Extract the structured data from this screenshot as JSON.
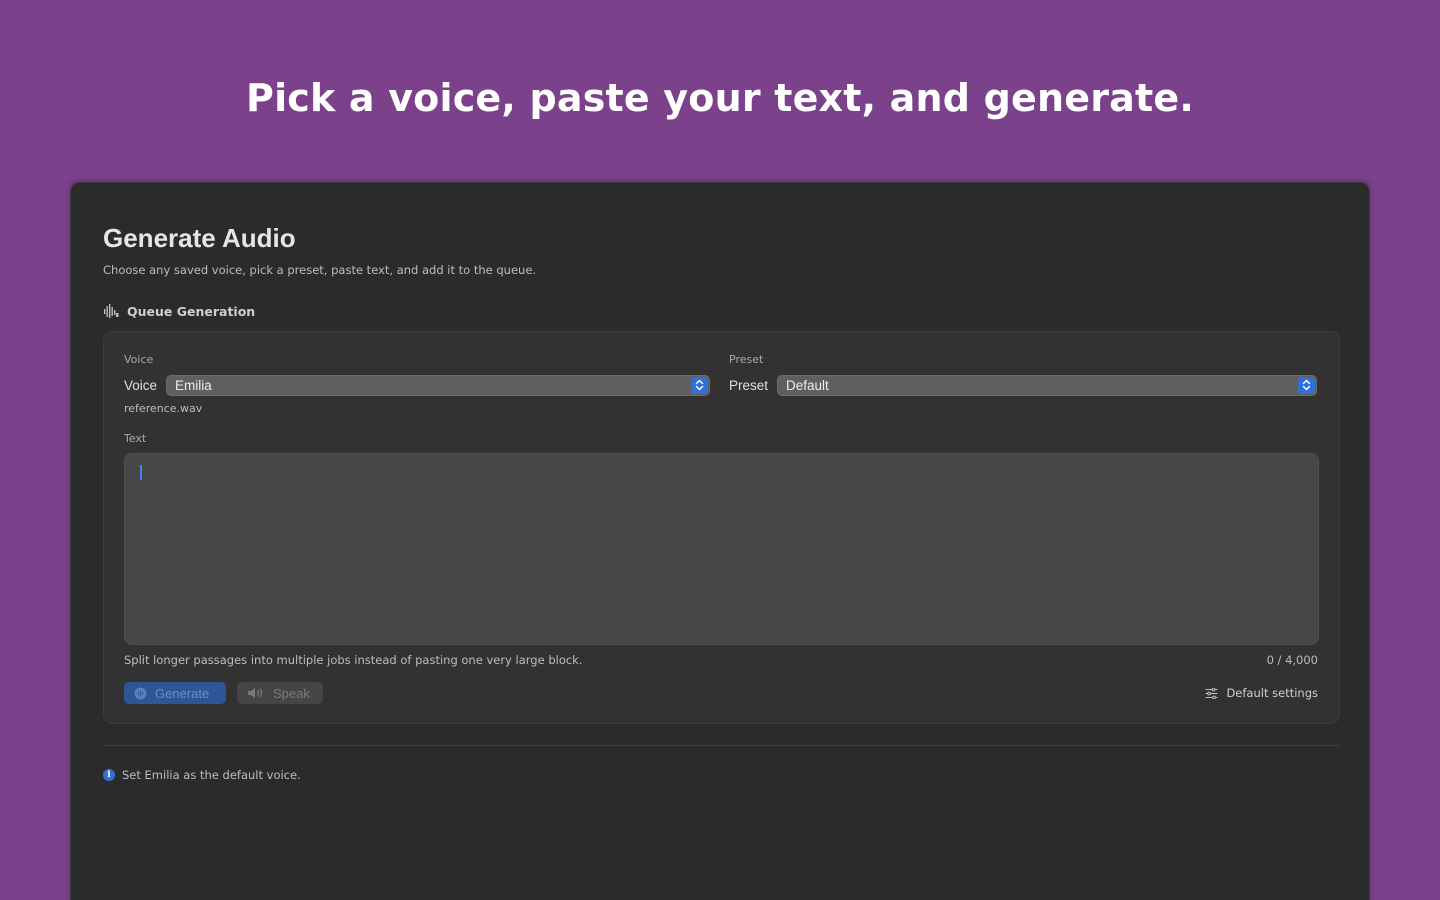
{
  "headline": "Pick a voice, paste your text, and generate.",
  "page": {
    "title": "Generate Audio",
    "subtitle": "Choose any saved voice, pick a preset, paste text, and add it to the queue."
  },
  "section": {
    "title": "Queue Generation",
    "icon": "waveform-icon"
  },
  "voice": {
    "caption": "Voice",
    "label": "Voice",
    "selected": "Emilia",
    "file": "reference.wav"
  },
  "preset": {
    "caption": "Preset",
    "label": "Preset",
    "selected": "Default"
  },
  "text": {
    "caption": "Text",
    "value": "",
    "hint": "Split longer passages into multiple jobs instead of pasting one very large block.",
    "counter": "0 / 4,000"
  },
  "actions": {
    "generate_label": "Generate",
    "speak_label": "Speak",
    "settings_label": "Default settings"
  },
  "status": {
    "message": "Set Emilia as the default voice."
  },
  "colors": {
    "background": "#7b418b",
    "window": "#2b2b2b",
    "accent": "#2f6fd6"
  }
}
